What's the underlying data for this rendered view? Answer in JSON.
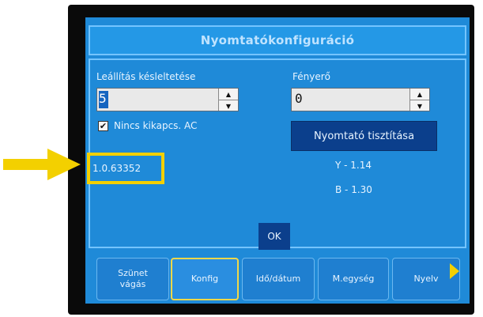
{
  "dialog": {
    "title": "Nyomtatókonfiguráció"
  },
  "settings": {
    "shutdown_delay_label": "Leállítás késleltetése",
    "shutdown_delay_value": "5",
    "no_shutdown_ac_label": "Nincs kikapcs. AC",
    "no_shutdown_ac_checked": true,
    "brightness_label": "Fényerő",
    "brightness_value": "0",
    "clean_printer_label": "Nyomtató tisztítása"
  },
  "info": {
    "version": "1.0.63352",
    "y_value": "Y - 1.14",
    "b_value": "B - 1.30"
  },
  "ok_label": "OK",
  "tabs": [
    {
      "line1": "Szünet",
      "line2": "vágás",
      "active": false
    },
    {
      "line1": "Konfig",
      "line2": "",
      "active": true
    },
    {
      "line1": "Idő/dátum",
      "line2": "",
      "active": false
    },
    {
      "line1": "M.egység",
      "line2": "",
      "active": false
    },
    {
      "line1": "Nyelv",
      "line2": "",
      "active": false
    }
  ],
  "colors": {
    "screen": "#1f8ad8",
    "highlight": "#f3d000",
    "button": "#0b3f8c"
  }
}
